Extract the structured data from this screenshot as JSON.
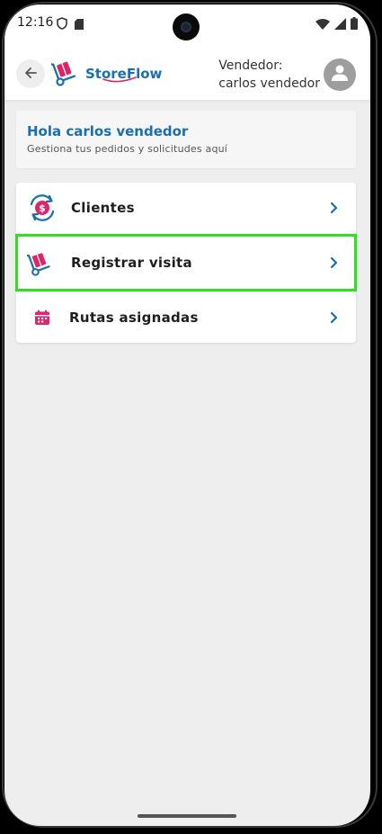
{
  "status_bar": {
    "time": "12:16"
  },
  "header": {
    "logo_text": "StoreFlow",
    "vendor_label": "Vendedor:",
    "vendor_name": "carlos vendedor"
  },
  "greeting": {
    "title": "Hola carlos vendedor",
    "subtitle": "Gestiona tus pedidos y solicitudes aquí"
  },
  "menu": {
    "items": [
      {
        "label": "Clientes",
        "icon": "client-money-icon"
      },
      {
        "label": "Registrar visita",
        "icon": "hand-truck-icon"
      },
      {
        "label": "Rutas asignadas",
        "icon": "calendar-icon"
      }
    ]
  },
  "colors": {
    "brand_blue": "#1a6fb0",
    "brand_pink": "#e0246c",
    "highlight_green": "#33dd22",
    "background": "#eeeeee"
  }
}
